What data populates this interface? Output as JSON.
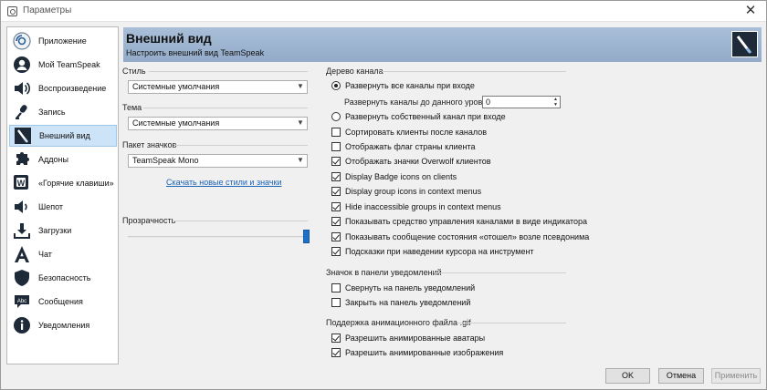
{
  "window": {
    "title": "Параметры",
    "close": "✕"
  },
  "colors": {
    "accent": "#1f6fc6",
    "header_gradient_top": "#a9bfd8",
    "header_gradient_bottom": "#93abc9",
    "selected_item": "#cde3f7",
    "link": "#1c64b8"
  },
  "sidebar": {
    "items": [
      {
        "label": "Приложение",
        "icon": "application-icon",
        "active": false
      },
      {
        "label": "Мой TeamSpeak",
        "icon": "user-icon",
        "active": false
      },
      {
        "label": "Воспроизведение",
        "icon": "speaker-icon",
        "active": false
      },
      {
        "label": "Запись",
        "icon": "microphone-icon",
        "active": false
      },
      {
        "label": "Внешний вид",
        "icon": "appearance-icon",
        "active": true
      },
      {
        "label": "Аддоны",
        "icon": "puzzle-icon",
        "active": false
      },
      {
        "label": "«Горячие клавиши»",
        "icon": "hotkeys-icon",
        "active": false
      },
      {
        "label": "Шепот",
        "icon": "whisper-icon",
        "active": false
      },
      {
        "label": "Загрузки",
        "icon": "download-icon",
        "active": false
      },
      {
        "label": "Чат",
        "icon": "chat-icon",
        "active": false
      },
      {
        "label": "Безопасность",
        "icon": "shield-icon",
        "active": false
      },
      {
        "label": "Сообщения",
        "icon": "messages-icon",
        "active": false
      },
      {
        "label": "Уведомления",
        "icon": "info-icon",
        "active": false
      }
    ]
  },
  "header": {
    "title": "Внешний вид",
    "subtitle": "Настроить внешний вид TeamSpeak",
    "logo": "teamspeak-logo-icon"
  },
  "left": {
    "style_label": "Стиль",
    "style_value": "Системные умолчания",
    "theme_label": "Тема",
    "theme_value": "Системные умолчания",
    "icons_label": "Пакет значков",
    "icons_value": "TeamSpeak Mono",
    "download_link": "Скачать новые стили и значки",
    "transparency_label": "Прозрачность",
    "transparency_level": 1.0
  },
  "channel_tree": {
    "label": "Дерево канала",
    "radio_expand_all": "Развернуть все каналы при входе",
    "expand_level_label": "Развернуть каналы до данного уровня:",
    "expand_level_value": "0",
    "radio_expand_own": "Развернуть собственный канал при входе",
    "options": [
      {
        "label": "Сортировать клиенты после каналов",
        "checked": false
      },
      {
        "label": "Отображать флаг страны клиента",
        "checked": false
      },
      {
        "label": "Отображать значки Overwolf клиентов",
        "checked": true
      },
      {
        "label": "Display Badge icons on clients",
        "checked": true
      },
      {
        "label": "Display group icons in context menus",
        "checked": true
      },
      {
        "label": "Hide inaccessible groups in context menus",
        "checked": true
      },
      {
        "label": "Показывать средство управления каналами в виде индикатора",
        "checked": true
      },
      {
        "label": "Показывать сообщение состояния «отошел» возле псевдонима",
        "checked": true
      },
      {
        "label": "Подсказки при наведении курсора на инструмент",
        "checked": true
      }
    ]
  },
  "tray": {
    "label": "Значок в панели уведомлений",
    "options": [
      {
        "label": "Свернуть на панель уведомлений",
        "checked": false
      },
      {
        "label": "Закрыть на панель уведомлений",
        "checked": false
      }
    ]
  },
  "gif": {
    "label": "Поддержка анимационного файла .gif",
    "options": [
      {
        "label": "Разрешить анимированные аватары",
        "checked": true
      },
      {
        "label": "Разрешить анимированные изображения",
        "checked": true
      }
    ]
  },
  "buttons": {
    "ok": "OK",
    "cancel": "Отмена",
    "apply": "Применить"
  }
}
